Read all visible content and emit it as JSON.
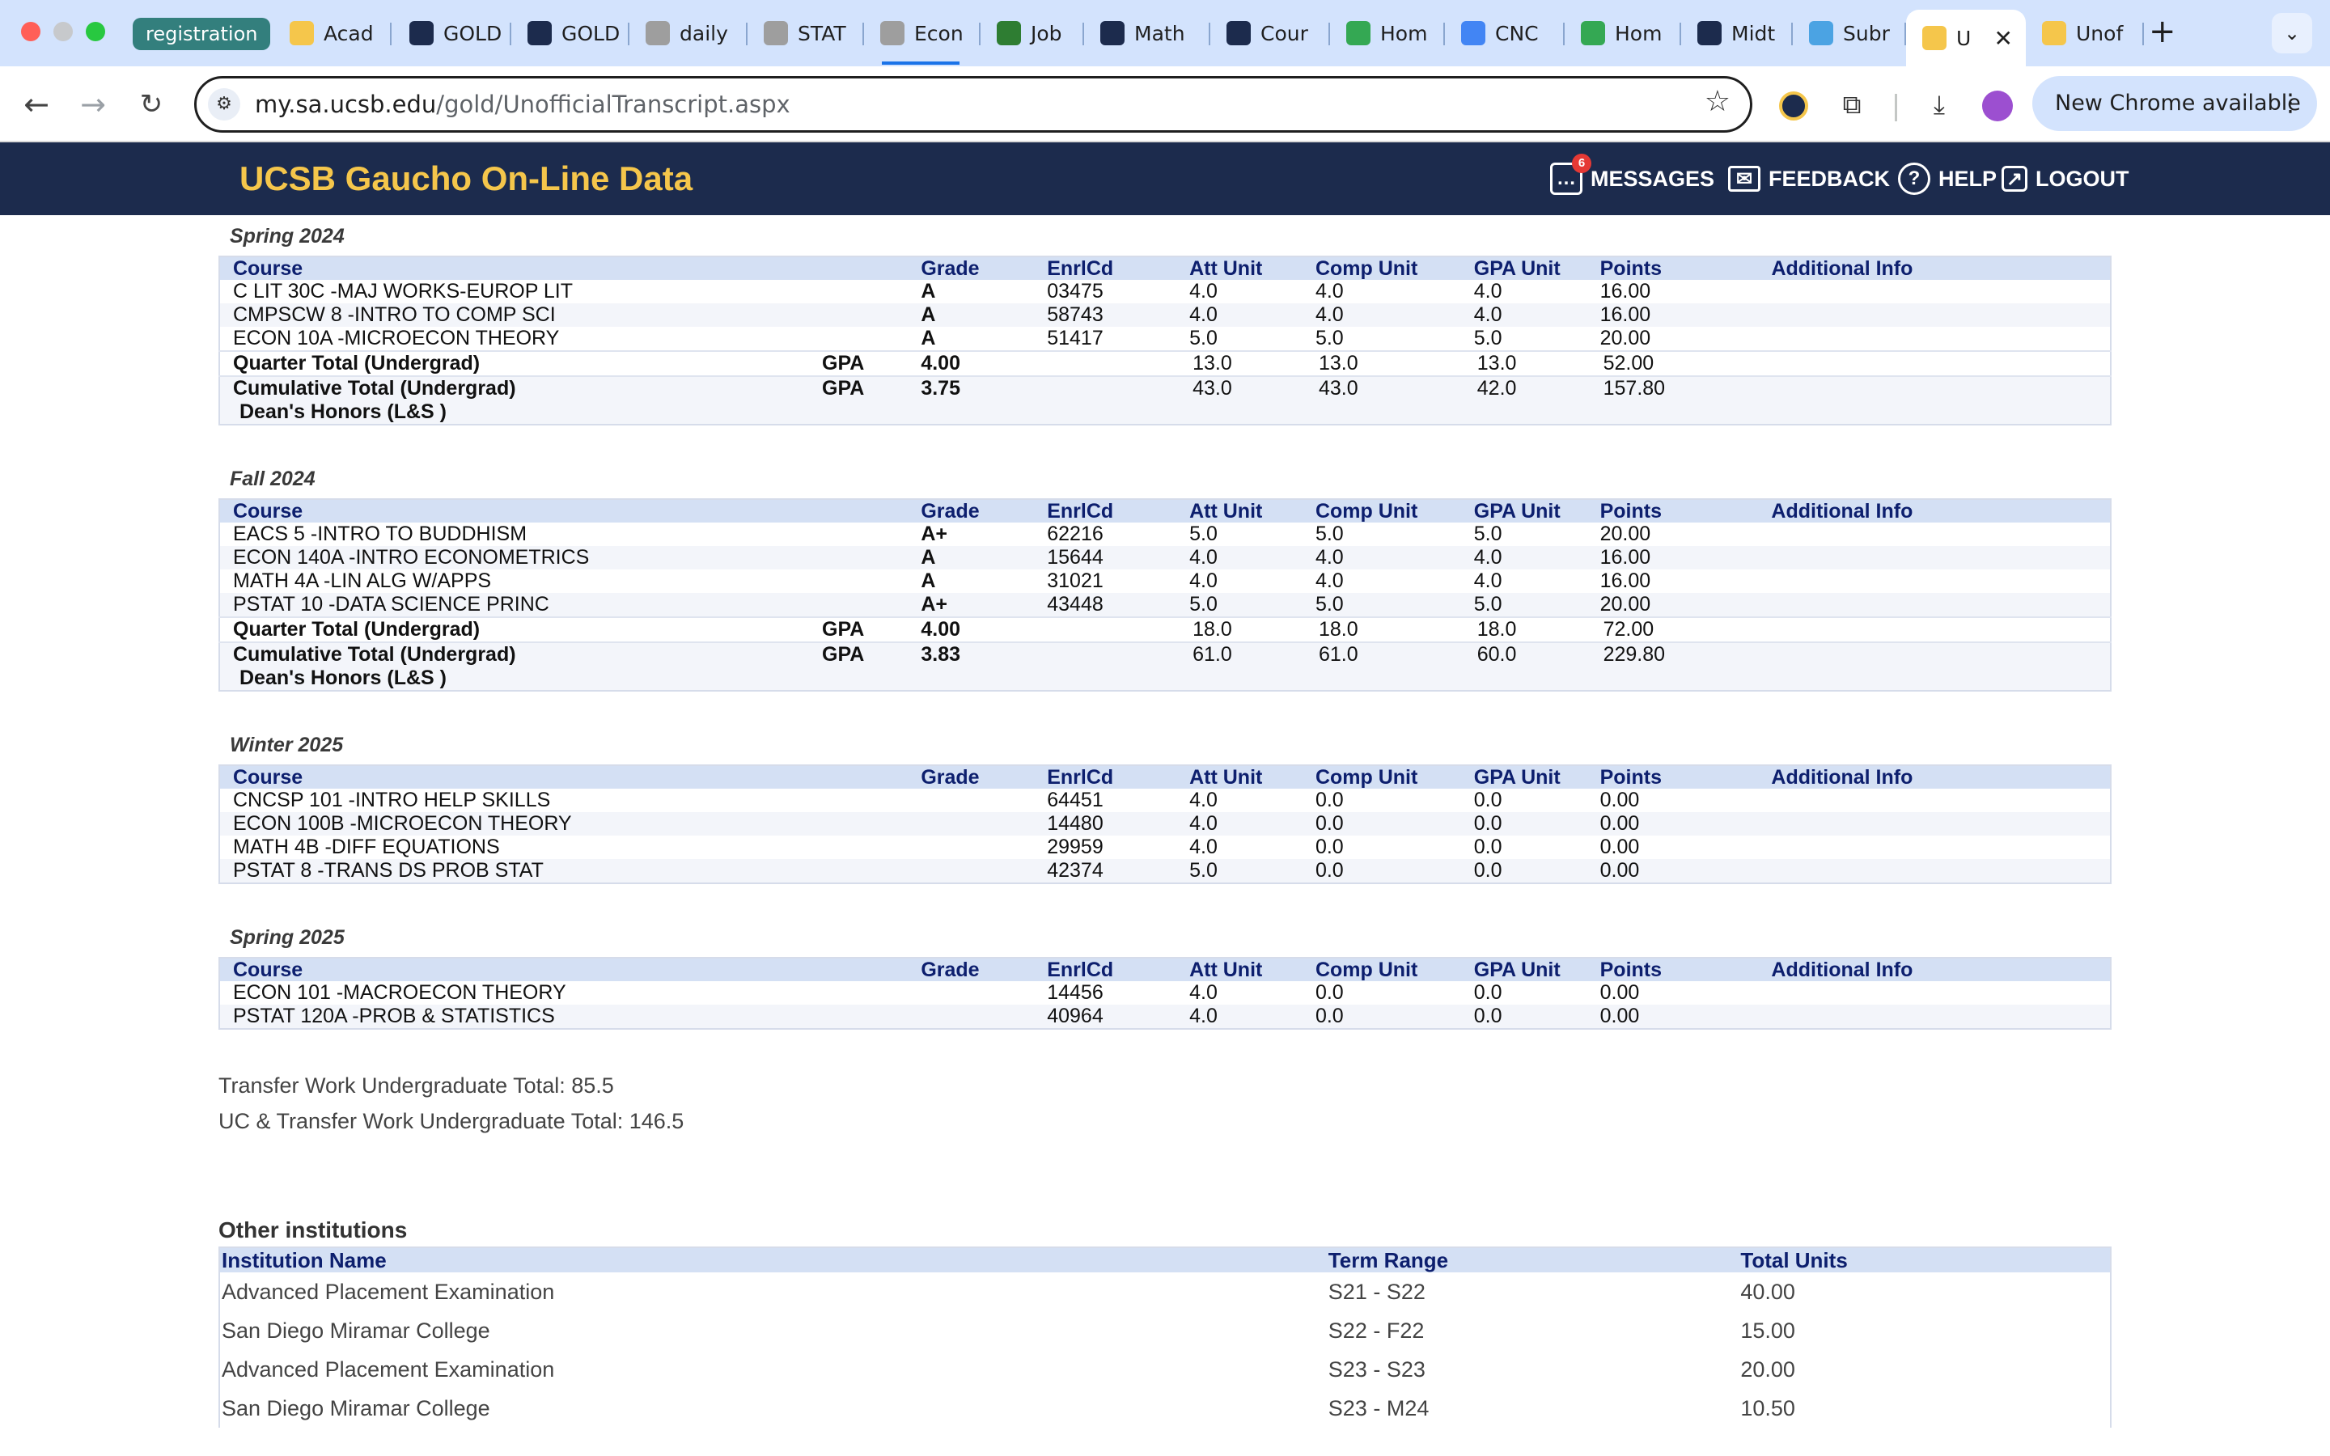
{
  "browser": {
    "tab_group_label": "registration",
    "tabs": [
      {
        "title": "Acad",
        "icon": "gaucho-logo-icon",
        "color": "#f5c64b"
      },
      {
        "title": "GOLD",
        "icon": "ucsb-logo-icon",
        "color": "#1c2b4d"
      },
      {
        "title": "GOLD",
        "icon": "ucsb-logo-icon",
        "color": "#1c2b4d"
      },
      {
        "title": "daily",
        "icon": "globe-icon",
        "color": "#9e9e9e"
      },
      {
        "title": "STAT",
        "icon": "globe-icon",
        "color": "#9e9e9e"
      },
      {
        "title": "Econ",
        "icon": "globe-icon",
        "color": "#9e9e9e"
      },
      {
        "title": "Job",
        "icon": "handshake-icon",
        "color": "#2e7d32"
      },
      {
        "title": "Math",
        "icon": "gradescope-icon",
        "color": "#1c2b4d"
      },
      {
        "title": "Cour",
        "icon": "gradescope-icon",
        "color": "#1c2b4d"
      },
      {
        "title": "Hom",
        "icon": "google-drive-icon",
        "color": "#34a853"
      },
      {
        "title": "CNC",
        "icon": "google-docs-icon",
        "color": "#4285f4"
      },
      {
        "title": "Hom",
        "icon": "google-drive-icon",
        "color": "#34a853"
      },
      {
        "title": "Midt",
        "icon": "gradescope-icon",
        "color": "#1c2b4d"
      },
      {
        "title": "Subr",
        "icon": "cloud-icon",
        "color": "#4ba3e3"
      },
      {
        "title": "U",
        "icon": "gaucho-logo-icon",
        "color": "#f5c64b",
        "active": true
      },
      {
        "title": "Unof",
        "icon": "gaucho-logo-icon",
        "color": "#f5c64b"
      }
    ],
    "url_host": "my.sa.ucsb.edu",
    "url_path": "/gold/UnofficialTranscript.aspx",
    "update_label": "New Chrome available"
  },
  "header": {
    "brand": "UCSB Gaucho On-Line Data",
    "messages_label": "MESSAGES",
    "messages_count": "6",
    "feedback_label": "FEEDBACK",
    "help_label": "HELP",
    "logout_label": "LOGOUT"
  },
  "columns": [
    "Course",
    "Grade",
    "EnrlCd",
    "Att Unit",
    "Comp Unit",
    "GPA Unit",
    "Points",
    "Additional Info"
  ],
  "terms": [
    {
      "name": "Spring 2024",
      "courses": [
        {
          "course": "C LIT 30C -MAJ WORKS-EUROP LIT",
          "grade": "A",
          "enrl": "03475",
          "att": "4.0",
          "comp": "4.0",
          "gpa": "4.0",
          "points": "16.00"
        },
        {
          "course": "CMPSCW 8 -INTRO TO COMP SCI",
          "grade": "A",
          "enrl": "58743",
          "att": "4.0",
          "comp": "4.0",
          "gpa": "4.0",
          "points": "16.00"
        },
        {
          "course": "ECON 10A -MICROECON THEORY",
          "grade": "A",
          "enrl": "51417",
          "att": "5.0",
          "comp": "5.0",
          "gpa": "5.0",
          "points": "20.00"
        }
      ],
      "quarter": {
        "label": "Quarter Total (Undergrad)",
        "gpa_label": "GPA",
        "gpa": "4.00",
        "att": "13.0",
        "comp": "13.0",
        "gpa_unit": "13.0",
        "points": "52.00"
      },
      "cumulative": {
        "label": "Cumulative Total (Undergrad)",
        "gpa_label": "GPA",
        "gpa": "3.75",
        "att": "43.0",
        "comp": "43.0",
        "gpa_unit": "42.0",
        "points": "157.80",
        "honors": "Dean's Honors (L&S )"
      }
    },
    {
      "name": "Fall 2024",
      "courses": [
        {
          "course": "EACS 5 -INTRO TO BUDDHISM",
          "grade": "A+",
          "enrl": "62216",
          "att": "5.0",
          "comp": "5.0",
          "gpa": "5.0",
          "points": "20.00"
        },
        {
          "course": "ECON 140A -INTRO ECONOMETRICS",
          "grade": "A",
          "enrl": "15644",
          "att": "4.0",
          "comp": "4.0",
          "gpa": "4.0",
          "points": "16.00"
        },
        {
          "course": "MATH 4A -LIN ALG W/APPS",
          "grade": "A",
          "enrl": "31021",
          "att": "4.0",
          "comp": "4.0",
          "gpa": "4.0",
          "points": "16.00"
        },
        {
          "course": "PSTAT 10 -DATA SCIENCE PRINC",
          "grade": "A+",
          "enrl": "43448",
          "att": "5.0",
          "comp": "5.0",
          "gpa": "5.0",
          "points": "20.00"
        }
      ],
      "quarter": {
        "label": "Quarter Total (Undergrad)",
        "gpa_label": "GPA",
        "gpa": "4.00",
        "att": "18.0",
        "comp": "18.0",
        "gpa_unit": "18.0",
        "points": "72.00"
      },
      "cumulative": {
        "label": "Cumulative Total (Undergrad)",
        "gpa_label": "GPA",
        "gpa": "3.83",
        "att": "61.0",
        "comp": "61.0",
        "gpa_unit": "60.0",
        "points": "229.80",
        "honors": "Dean's Honors (L&S )"
      }
    },
    {
      "name": "Winter 2025",
      "courses": [
        {
          "course": "CNCSP 101 -INTRO HELP SKILLS",
          "grade": "",
          "enrl": "64451",
          "att": "4.0",
          "comp": "0.0",
          "gpa": "0.0",
          "points": "0.00"
        },
        {
          "course": "ECON 100B -MICROECON THEORY",
          "grade": "",
          "enrl": "14480",
          "att": "4.0",
          "comp": "0.0",
          "gpa": "0.0",
          "points": "0.00"
        },
        {
          "course": "MATH 4B -DIFF EQUATIONS",
          "grade": "",
          "enrl": "29959",
          "att": "4.0",
          "comp": "0.0",
          "gpa": "0.0",
          "points": "0.00"
        },
        {
          "course": "PSTAT 8 -TRANS DS PROB STAT",
          "grade": "",
          "enrl": "42374",
          "att": "5.0",
          "comp": "0.0",
          "gpa": "0.0",
          "points": "0.00"
        }
      ]
    },
    {
      "name": "Spring 2025",
      "courses": [
        {
          "course": "ECON 101 -MACROECON THEORY",
          "grade": "",
          "enrl": "14456",
          "att": "4.0",
          "comp": "0.0",
          "gpa": "0.0",
          "points": "0.00"
        },
        {
          "course": "PSTAT 120A -PROB & STATISTICS",
          "grade": "",
          "enrl": "40964",
          "att": "4.0",
          "comp": "0.0",
          "gpa": "0.0",
          "points": "0.00"
        }
      ]
    }
  ],
  "totals": {
    "transfer": "Transfer Work Undergraduate Total: 85.5",
    "uc_transfer": "UC & Transfer Work Undergraduate Total: 146.5"
  },
  "other_institutions": {
    "title": "Other institutions",
    "columns": [
      "Institution Name",
      "Term Range",
      "Total Units"
    ],
    "rows": [
      {
        "name": "Advanced Placement Examination",
        "range": "S21 - S22",
        "units": "40.00"
      },
      {
        "name": "San Diego Miramar College",
        "range": "S22 - F22",
        "units": "15.00"
      },
      {
        "name": "Advanced Placement Examination",
        "range": "S23 - S23",
        "units": "20.00"
      },
      {
        "name": "San Diego Miramar College",
        "range": "S23 - M24",
        "units": "10.50"
      }
    ]
  }
}
